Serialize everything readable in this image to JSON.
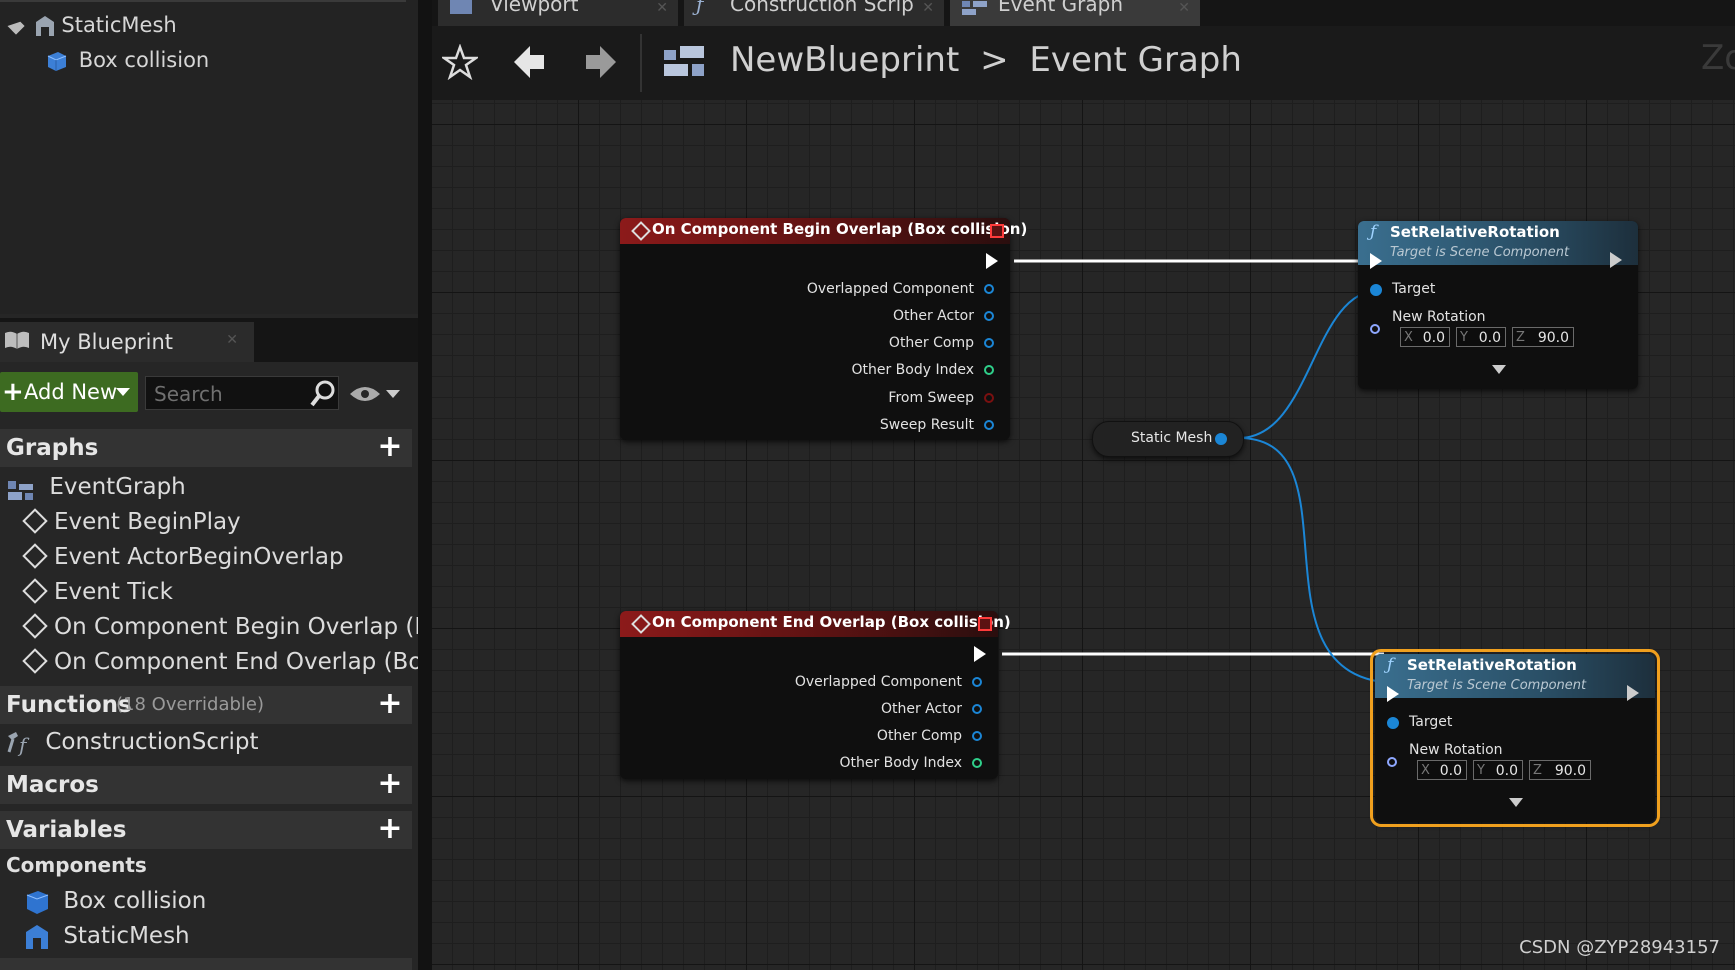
{
  "components_tree": {
    "items": [
      {
        "label": "StaticMesh",
        "icon": "static-mesh-icon"
      },
      {
        "label": "Box collision",
        "icon": "box-collision-icon"
      }
    ]
  },
  "my_blueprint": {
    "tab_label": "My Blueprint",
    "add_new_label": "Add New",
    "search_placeholder": "Search",
    "sections": {
      "graphs": {
        "label": "Graphs",
        "items": [
          {
            "label": "EventGraph"
          },
          {
            "label": "Event BeginPlay"
          },
          {
            "label": "Event ActorBeginOverlap"
          },
          {
            "label": "Event Tick"
          },
          {
            "label": "On Component Begin Overlap (Bo"
          },
          {
            "label": "On Component End Overlap (Box"
          }
        ]
      },
      "functions": {
        "label": "Functions",
        "count": "(18 Overridable)",
        "items": [
          {
            "label": "ConstructionScript"
          }
        ]
      },
      "macros": {
        "label": "Macros"
      },
      "variables": {
        "label": "Variables"
      },
      "components": {
        "label": "Components",
        "items": [
          {
            "label": "Box collision"
          },
          {
            "label": "StaticMesh"
          }
        ]
      }
    }
  },
  "editor_tabs": [
    {
      "label": "Viewport",
      "icon": "viewport-icon"
    },
    {
      "label": "Construction Scrip",
      "icon": "function-icon"
    },
    {
      "label": "Event Graph",
      "icon": "event-graph-icon"
    }
  ],
  "toolbar": {
    "breadcrumb_root": "NewBlueprint",
    "breadcrumb_separator": ">",
    "breadcrumb_current": "Event Graph",
    "zoom_partial": "Zo"
  },
  "nodes": {
    "begin_overlap": {
      "title": "On Component Begin Overlap (Box collision)",
      "pins": [
        "Overlapped Component",
        "Other Actor",
        "Other Comp",
        "Other Body Index",
        "From Sweep",
        "Sweep Result"
      ]
    },
    "end_overlap": {
      "title": "On Component End Overlap (Box collision)",
      "pins": [
        "Overlapped Component",
        "Other Actor",
        "Other Comp",
        "Other Body Index"
      ]
    },
    "static_mesh_var": {
      "label": "Static Mesh"
    },
    "set_rot_1": {
      "title": "SetRelativeRotation",
      "subtitle": "Target is Scene Component",
      "target_label": "Target",
      "rotation_label": "New Rotation",
      "x_axis": "X",
      "x": "0.0",
      "y_axis": "Y",
      "y": "0.0",
      "z_axis": "Z",
      "z": "90.0"
    },
    "set_rot_2": {
      "title": "SetRelativeRotation",
      "subtitle": "Target is Scene Component",
      "target_label": "Target",
      "rotation_label": "New Rotation",
      "x_axis": "X",
      "x": "0.0",
      "y_axis": "Y",
      "y": "0.0",
      "z_axis": "Z",
      "z": "90.0"
    }
  },
  "watermark": "CSDN @ZYP28943157",
  "colors": {
    "event_header": "#8c1a1a",
    "function_header": "#3a6f8f",
    "object_pin": "#1b86d6",
    "int_pin": "#2fcf8a",
    "bool_pin": "#7a1010",
    "selected_outline": "#f0a01e",
    "add_new_button": "#3d6b21"
  }
}
